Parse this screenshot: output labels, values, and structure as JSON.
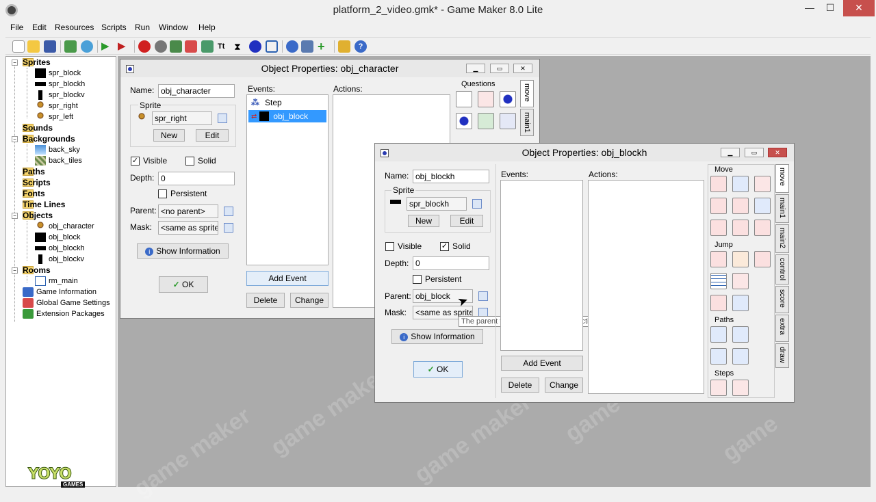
{
  "app": {
    "title": "platform_2_video.gmk* - Game Maker 8.0 Lite"
  },
  "menu": [
    "File",
    "Edit",
    "Resources",
    "Scripts",
    "Run",
    "Window",
    "Help"
  ],
  "tree": {
    "sprites": {
      "label": "Sprites",
      "items": [
        "spr_block",
        "spr_blockh",
        "spr_blockv",
        "spr_right",
        "spr_left"
      ]
    },
    "sounds": {
      "label": "Sounds"
    },
    "backgrounds": {
      "label": "Backgrounds",
      "items": [
        "back_sky",
        "back_tiles"
      ]
    },
    "paths": {
      "label": "Paths"
    },
    "scripts": {
      "label": "Scripts"
    },
    "fonts": {
      "label": "Fonts"
    },
    "timelines": {
      "label": "Time Lines"
    },
    "objects": {
      "label": "Objects",
      "items": [
        "obj_character",
        "obj_block",
        "obj_blockh",
        "obj_blockv"
      ]
    },
    "rooms": {
      "label": "Rooms",
      "items": [
        "rm_main"
      ]
    },
    "extra": [
      "Game Information",
      "Global Game Settings",
      "Extension Packages"
    ]
  },
  "logo": {
    "main": "YOYO",
    "sub": "GAMES"
  },
  "dlg1": {
    "title": "Object Properties: obj_character",
    "name_label": "Name:",
    "name_value": "obj_character",
    "sprite_group": "Sprite",
    "sprite_value": "spr_right",
    "new_btn": "New",
    "edit_btn": "Edit",
    "visible_label": "Visible",
    "solid_label": "Solid",
    "depth_label": "Depth:",
    "depth_value": "0",
    "persistent_label": "Persistent",
    "parent_label": "Parent:",
    "parent_value": "<no parent>",
    "mask_label": "Mask:",
    "mask_value": "<same as sprite>",
    "show_info": "Show Information",
    "ok": "OK",
    "events_label": "Events:",
    "events": [
      "Step",
      "obj_block"
    ],
    "actions_label": "Actions:",
    "add_event": "Add Event",
    "delete": "Delete",
    "change": "Change",
    "palette_group": "Questions",
    "tabs": [
      "move",
      "main1"
    ]
  },
  "dlg2": {
    "title": "Object Properties: obj_blockh",
    "name_label": "Name:",
    "name_value": "obj_blockh",
    "sprite_group": "Sprite",
    "sprite_value": "spr_blockh",
    "new_btn": "New",
    "edit_btn": "Edit",
    "visible_label": "Visible",
    "solid_label": "Solid",
    "depth_label": "Depth:",
    "depth_value": "0",
    "persistent_label": "Persistent",
    "parent_label": "Parent:",
    "parent_value": "obj_block",
    "mask_label": "Mask:",
    "mask_value": "<same as sprite>",
    "show_info": "Show Information",
    "ok": "OK",
    "events_label": "Events:",
    "actions_label": "Actions:",
    "add_event": "Add Event",
    "delete": "Delete",
    "change": "Change",
    "tooltip": "The parent from which events and actions are",
    "palette_groups": [
      "Move",
      "Jump",
      "Paths",
      "Steps"
    ],
    "tabs": [
      "move",
      "main1",
      "main2",
      "control",
      "score",
      "extra",
      "draw"
    ]
  },
  "colors": {
    "accent": "#3399ff",
    "close": "#c7504d",
    "mdi_bg": "#ababab"
  }
}
